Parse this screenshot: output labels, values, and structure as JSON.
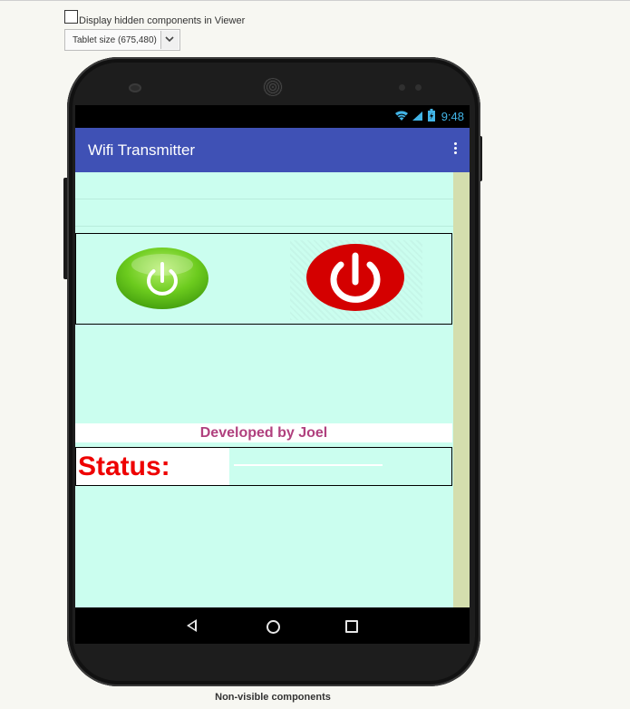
{
  "viewer_options": {
    "hidden_components_label": "Display hidden components in Viewer",
    "hidden_components_checked": false,
    "screen_size_selected": "Tablet size (675,480)"
  },
  "status_bar": {
    "time": "9:48"
  },
  "app_bar": {
    "title": "Wifi Transmitter"
  },
  "main": {
    "developer_label": "Developed by Joel",
    "status_label": "Status:",
    "status_value": ""
  },
  "footer": {
    "non_visible_label": "Non-visible components"
  },
  "colors": {
    "app_bar": "#3f51b5",
    "screen_background": "#cbfeef",
    "developer_text": "#b0407e",
    "status_text": "#ee0000",
    "power_on": "#69c91c",
    "power_off": "#d40000"
  },
  "icons": [
    "wifi-icon",
    "signal-icon",
    "battery-icon",
    "overflow-menu-icon",
    "power-on-icon",
    "power-off-icon",
    "back-icon",
    "home-icon",
    "recent-apps-icon"
  ]
}
